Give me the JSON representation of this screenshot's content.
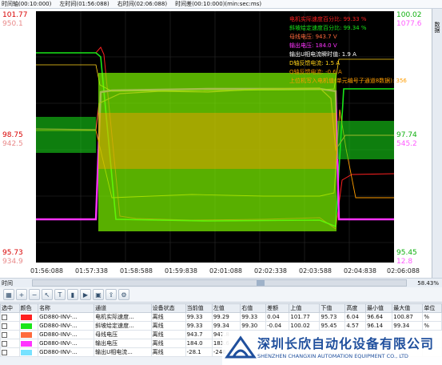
{
  "topbar": {
    "time": "时间轴(00:10:000)",
    "left": "左时间(01:56:088)",
    "right": "右时间(02:06:088)",
    "diff": "时间差(00:10:000)(min:sec:ms)"
  },
  "side_tab": "数据",
  "axes": {
    "left_red": [
      "101.77",
      "98.75",
      "95.73"
    ],
    "left_salmon": [
      "950.1",
      "942.5",
      "934.9"
    ],
    "right_green": [
      "100.02",
      "97.74",
      "95.45"
    ],
    "right_pink": [
      "1077.6",
      "545.2",
      "12.8"
    ],
    "x_ticks": [
      "01:56:088",
      "01:57:338",
      "01:58:588",
      "01:59:838",
      "02:01:088",
      "02:02:338",
      "02:03:588",
      "02:04:838",
      "02:06:088"
    ]
  },
  "legend": [
    {
      "text": "电机实际速度百分比: 99.33 %",
      "color": "#ff2020"
    },
    {
      "text": "斜坡给定速度百分比: 99.34 %",
      "color": "#19e619"
    },
    {
      "text": "母线电压: 943.7 V",
      "color": "#ff6a3c"
    },
    {
      "text": "输出电压: 184.0 V",
      "color": "#ff33ff"
    },
    {
      "text": "输出U相电流瞬时值: 1.9 A",
      "color": "#ffffff"
    },
    {
      "text": "D轴反馈电流: 1.5 A",
      "color": "#ffd21a"
    },
    {
      "text": "Q轴反馈电流: -0.6 A",
      "color": "#e68a00"
    },
    {
      "text": "上位机写入电机值(单元编号子通道8数据): 356",
      "color": "#ff9d00"
    }
  ],
  "timeline": {
    "label": "时间",
    "percent": "58.43%"
  },
  "toolbar_icons": [
    "grid-icon",
    "zoom-in-icon",
    "zoom-out-icon",
    "cursor-icon",
    "text-icon",
    "bar-icon",
    "play-icon",
    "save-icon",
    "export-icon",
    "settings-icon"
  ],
  "table": {
    "headers": [
      "选中",
      "颜色",
      "名称",
      "通道",
      "设备状态",
      "当前值",
      "左值",
      "右值",
      "差额",
      "上值",
      "下值",
      "高度",
      "最小值",
      "最大值",
      "单位"
    ],
    "rows": [
      {
        "color": "#ff2020",
        "cells": [
          "GD880-INV-...",
          "电机实际速度...",
          "离线",
          "99.33",
          "99.29",
          "99.33",
          "0.04",
          "101.77",
          "95.73",
          "6.04",
          "96.64",
          "100.87",
          "%"
        ]
      },
      {
        "color": "#19e619",
        "cells": [
          "GD880-INV-...",
          "斜坡给定速度...",
          "离线",
          "99.33",
          "99.34",
          "99.30",
          "-0.04",
          "100.02",
          "95.45",
          "4.57",
          "96.14",
          "99.34",
          "%"
        ]
      },
      {
        "color": "#ff6a3c",
        "cells": [
          "GD880-INV-...",
          "母线电压",
          "离线",
          "943.7",
          "947.8",
          "",
          "",
          "",
          "",
          "",
          "",
          "",
          ""
        ]
      },
      {
        "color": "#ff33ff",
        "cells": [
          "GD880-INV-...",
          "输出电压",
          "离线",
          "184.0",
          "183.6",
          "",
          "",
          "",
          "",
          "",
          "",
          "",
          ""
        ]
      },
      {
        "color": "#77e2ff",
        "cells": [
          "GD880-INV-...",
          "输出U相电流...",
          "离线",
          "-28.1",
          "-246.3",
          "",
          "",
          "",
          "",
          "",
          "",
          "",
          ""
        ]
      }
    ]
  },
  "logo": {
    "cn": "深圳长欣自动化设备有限公司",
    "en": "SHENZHEN CHANGXIN AUTOMATION EQUIPMENT CO., LTD"
  }
}
